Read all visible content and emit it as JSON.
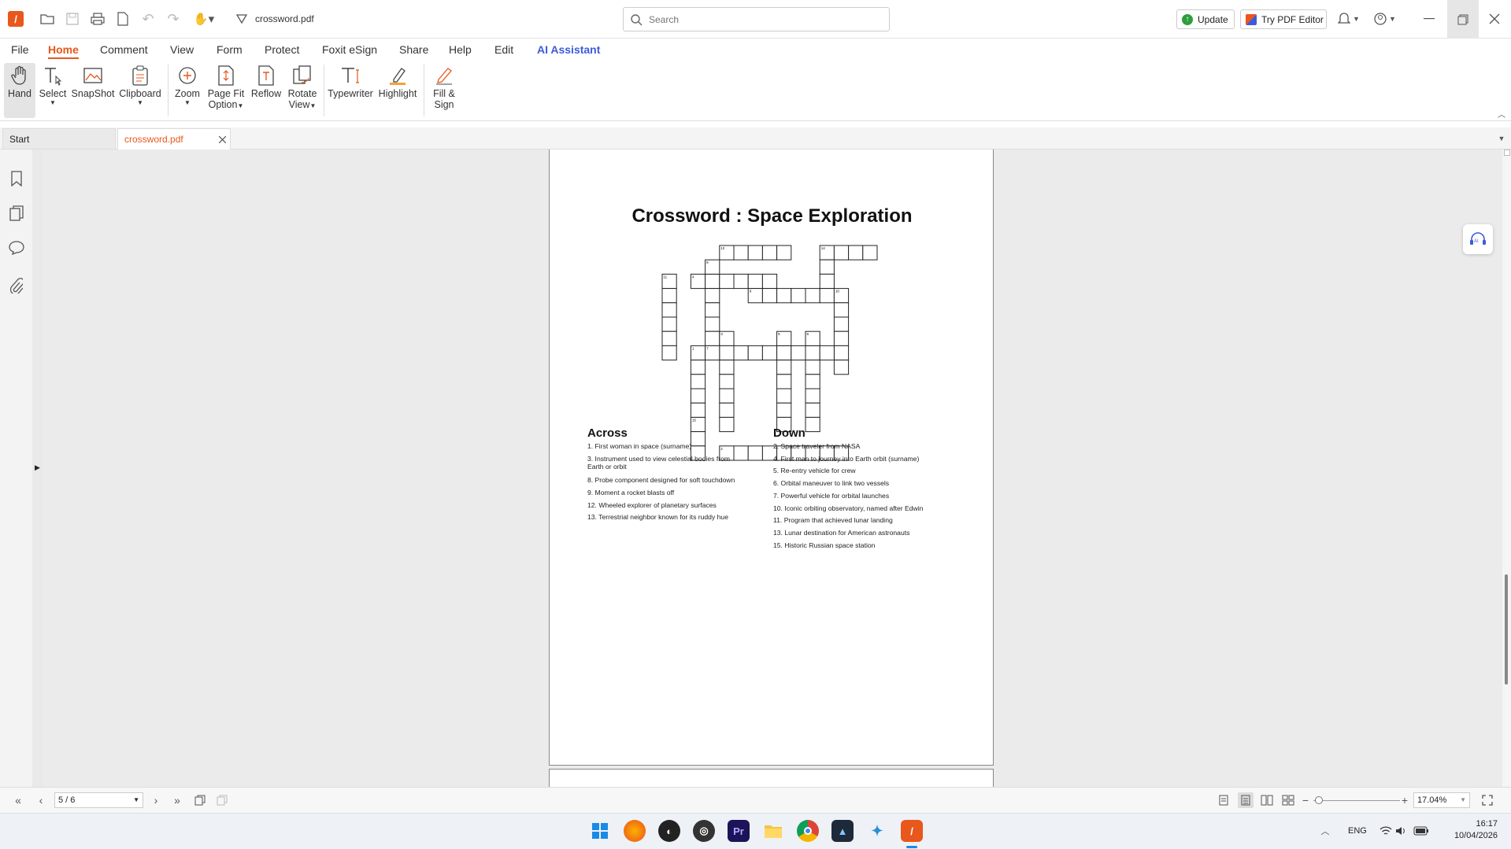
{
  "titlebar": {
    "filename": "crossword.pdf",
    "search_placeholder": "Search",
    "update": "Update",
    "try_editor": "Try PDF Editor"
  },
  "menu": [
    "File",
    "Home",
    "Comment",
    "View",
    "Form",
    "Protect",
    "Foxit eSign",
    "Share",
    "Help",
    "Edit",
    "AI Assistant"
  ],
  "ribbon": [
    {
      "label": "Hand",
      "icon": "hand-icon"
    },
    {
      "label": "Select",
      "icon": "select-text-icon",
      "dropdown": true
    },
    {
      "label": "SnapShot",
      "icon": "snapshot-icon"
    },
    {
      "label": "Clipboard",
      "icon": "clipboard-icon",
      "dropdown": true
    },
    {
      "label": "Zoom",
      "icon": "zoom-icon",
      "dropdown": true
    },
    {
      "label": "Page Fit",
      "label2": "Option",
      "icon": "page-fit-icon",
      "dropdown": true
    },
    {
      "label": "Reflow",
      "icon": "reflow-icon"
    },
    {
      "label": "Rotate",
      "label2": "View",
      "icon": "rotate-view-icon",
      "dropdown": true
    },
    {
      "label": "Typewriter",
      "icon": "typewriter-icon"
    },
    {
      "label": "Highlight",
      "icon": "highlight-icon"
    },
    {
      "label": "Fill &",
      "label2": "Sign",
      "icon": "fill-sign-icon"
    }
  ],
  "tabs": {
    "start": "Start",
    "active": "crossword.pdf"
  },
  "doc": {
    "title": "Crossword : Space Exploration",
    "across_heading": "Across",
    "down_heading": "Down",
    "across": [
      "1. First woman in space (surname)",
      "3. Instrument used to view celestial bodies from",
      "Earth or orbit",
      "8. Probe component designed for soft touchdown",
      "9. Moment a rocket blasts off",
      "12. Wheeled explorer of planetary surfaces",
      "13. Terrestrial neighbor known for its ruddy hue"
    ],
    "down": [
      "2. Space traveler from NASA",
      "4. First man to journey into Earth orbit (surname)",
      "5. Re-entry vehicle for crew",
      "6. Orbital maneuver to link two vessels",
      "7. Powerful vehicle for orbital launches",
      "10. Iconic orbiting observatory, named after Edwin",
      "11. Program that achieved lunar landing",
      "13. Lunar destination for American astronauts",
      "15. Historic Russian space station"
    ],
    "grid_numbers": [
      "12",
      "14",
      "11",
      "4",
      "8",
      "9",
      "10",
      "3",
      "5",
      "6",
      "1",
      "7",
      "15",
      "2"
    ]
  },
  "status": {
    "page": "5 / 6",
    "zoom": "17.04%"
  },
  "taskbar": {
    "lang": "ENG",
    "time": "16:17",
    "date": "10/04/2026"
  },
  "colors": {
    "accent": "#e8571c",
    "ai": "#3d5bd9"
  }
}
